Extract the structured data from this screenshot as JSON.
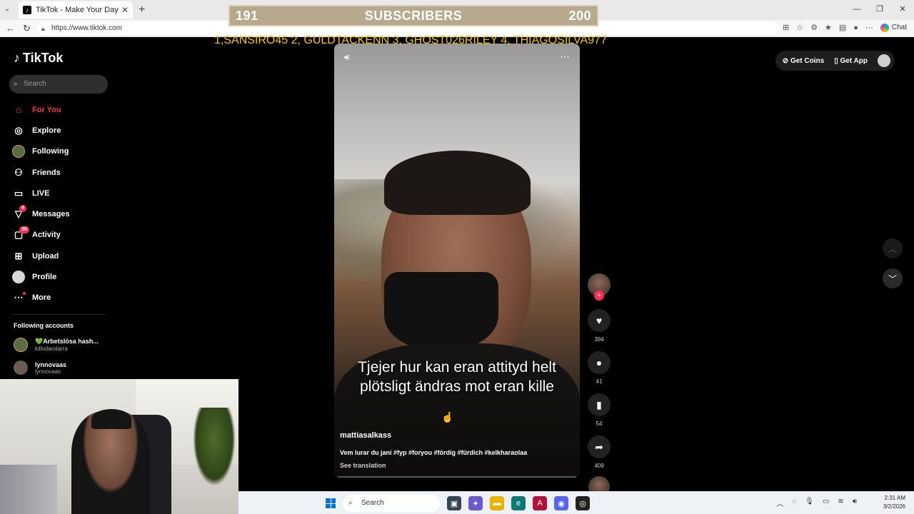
{
  "browser": {
    "tab_title": "TikTok - Make Your Day",
    "url": "https://www.tiktok.com",
    "chat_label": "Chat"
  },
  "overlay": {
    "subs_current": "191",
    "subs_label": "SUBSCRIBERS",
    "subs_goal": "200",
    "ticker": "1,SANSIRO45  2, GULDTACKENN 3, GHOST026RILEY 4, THIAGOSILVA977"
  },
  "tiktok": {
    "logo": "TikTok",
    "search_placeholder": "Search",
    "nav": [
      {
        "label": "For You",
        "icon": "home-icon"
      },
      {
        "label": "Explore",
        "icon": "compass-icon"
      },
      {
        "label": "Following",
        "icon": "following-avatar-icon"
      },
      {
        "label": "Friends",
        "icon": "friends-icon"
      },
      {
        "label": "LIVE",
        "icon": "live-icon"
      },
      {
        "label": "Messages",
        "icon": "messages-icon",
        "badge": "4"
      },
      {
        "label": "Activity",
        "icon": "activity-icon",
        "badge": "35"
      },
      {
        "label": "Upload",
        "icon": "upload-icon"
      },
      {
        "label": "Profile",
        "icon": "profile-icon"
      },
      {
        "label": "More",
        "icon": "more-icon"
      }
    ],
    "following_header": "Following accounts",
    "following_accounts": [
      {
        "name": "💚Arbetslösa hash...",
        "username": "killodandarra"
      },
      {
        "name": "lynnovaas",
        "username": "lynnovaas"
      }
    ],
    "get_coins": "Get Coins",
    "get_app": "Get App",
    "video": {
      "caption": "Tjejer hur kan eran attityd helt plötsligt ändras mot eran kille",
      "creator": "mattiasalkass",
      "description": "Vem lurar du jani #fyp #foryou #fördig #fürdich #kelkharaolaa",
      "see_translation": "See translation"
    },
    "actions": {
      "likes": "394",
      "comments": "41",
      "saves": "54",
      "shares": "409"
    }
  },
  "taskbar": {
    "search_label": "Search",
    "time": "2:31 AM",
    "date": "3/2/2026"
  },
  "colors": {
    "accent": "#fe2c55",
    "ticker": "#f5c518",
    "subs_bg": "#b7a98d"
  }
}
